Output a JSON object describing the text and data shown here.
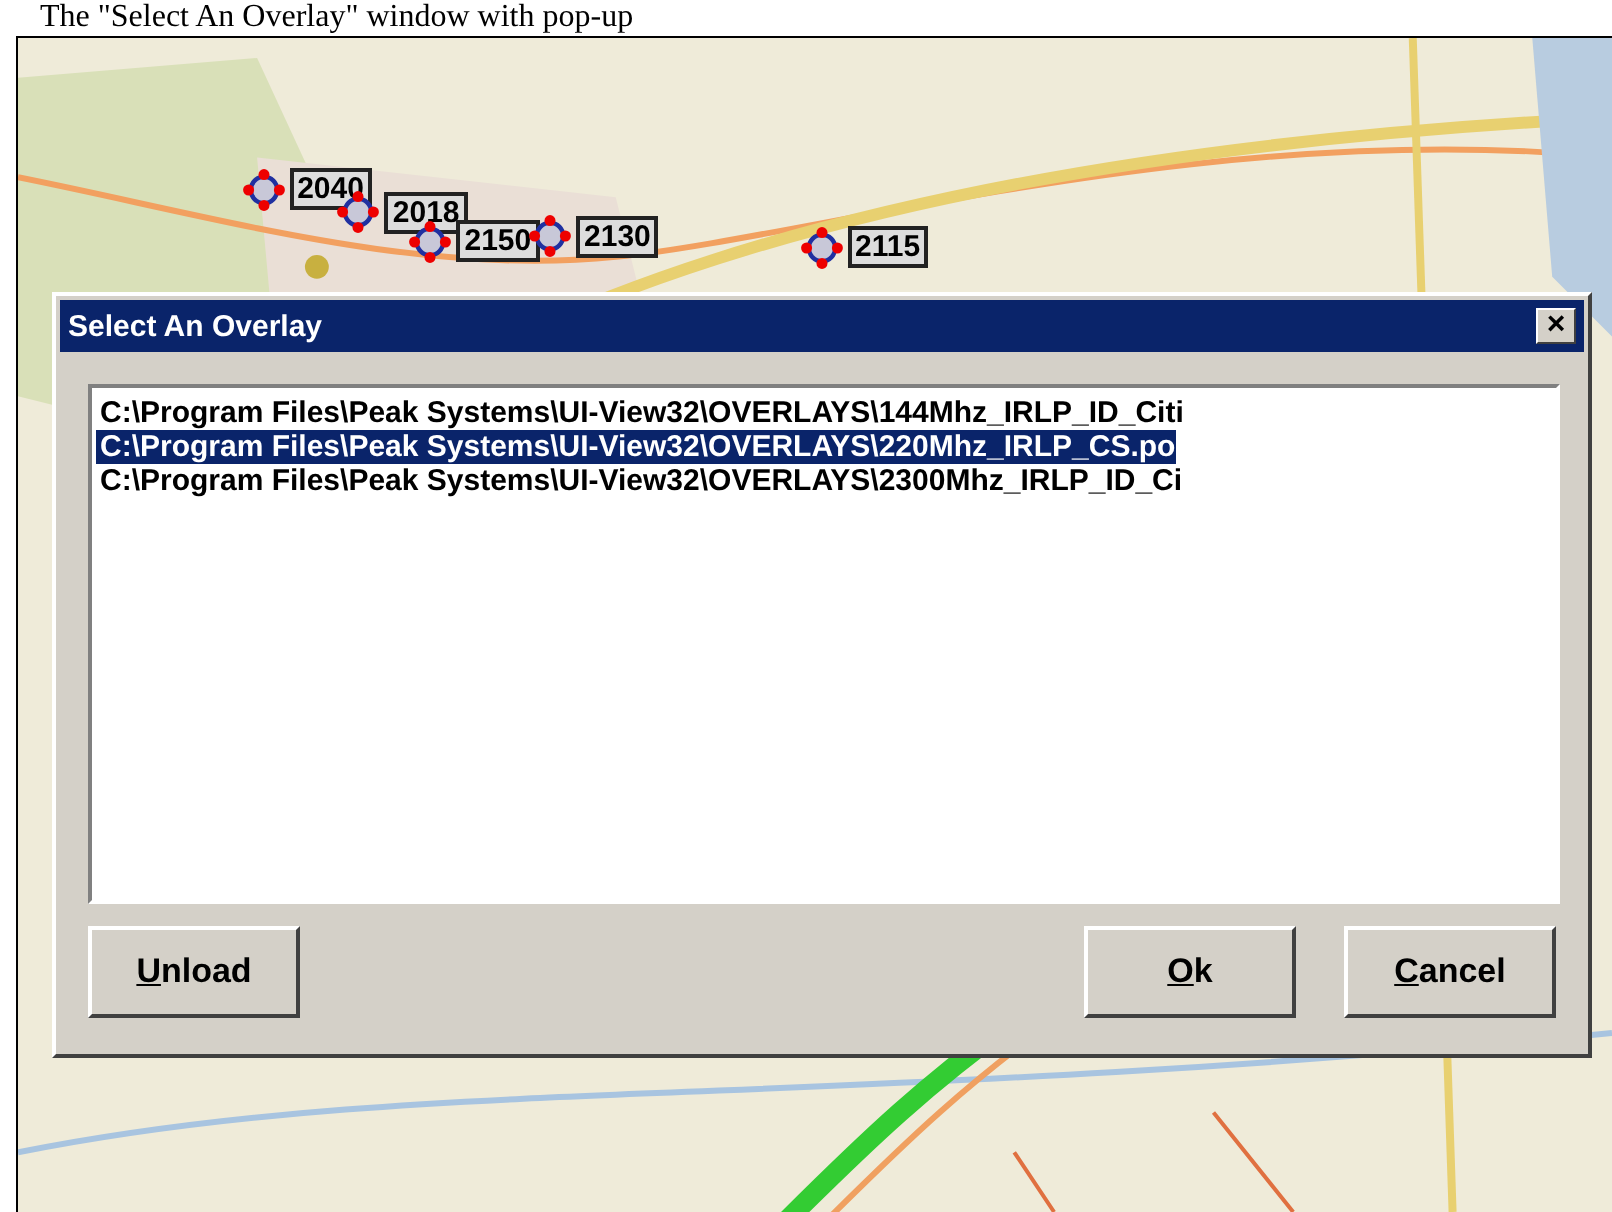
{
  "caption": "The \"Select An Overlay\" window with pop-up",
  "map": {
    "stations": [
      {
        "label": "2040"
      },
      {
        "label": "2018"
      },
      {
        "label": "2150"
      },
      {
        "label": "2130"
      },
      {
        "label": "2115"
      }
    ]
  },
  "dialog": {
    "title": "Select An Overlay",
    "close": "×",
    "items": [
      {
        "text": "C:\\Program Files\\Peak Systems\\UI-View32\\OVERLAYS\\144Mhz_IRLP_ID_Citi",
        "selected": false
      },
      {
        "text": "C:\\Program Files\\Peak Systems\\UI-View32\\OVERLAYS\\220Mhz_IRLP_CS.po",
        "selected": true
      },
      {
        "text": "C:\\Program Files\\Peak Systems\\UI-View32\\OVERLAYS\\2300Mhz_IRLP_ID_Ci",
        "selected": false
      }
    ],
    "buttons": [
      {
        "label": "Unload",
        "underlined": true,
        "kind": "left"
      },
      {
        "label": "Ok",
        "underlined": true,
        "kind": "right"
      },
      {
        "label": "Cancel",
        "underlined": true,
        "kind": "right"
      }
    ]
  }
}
